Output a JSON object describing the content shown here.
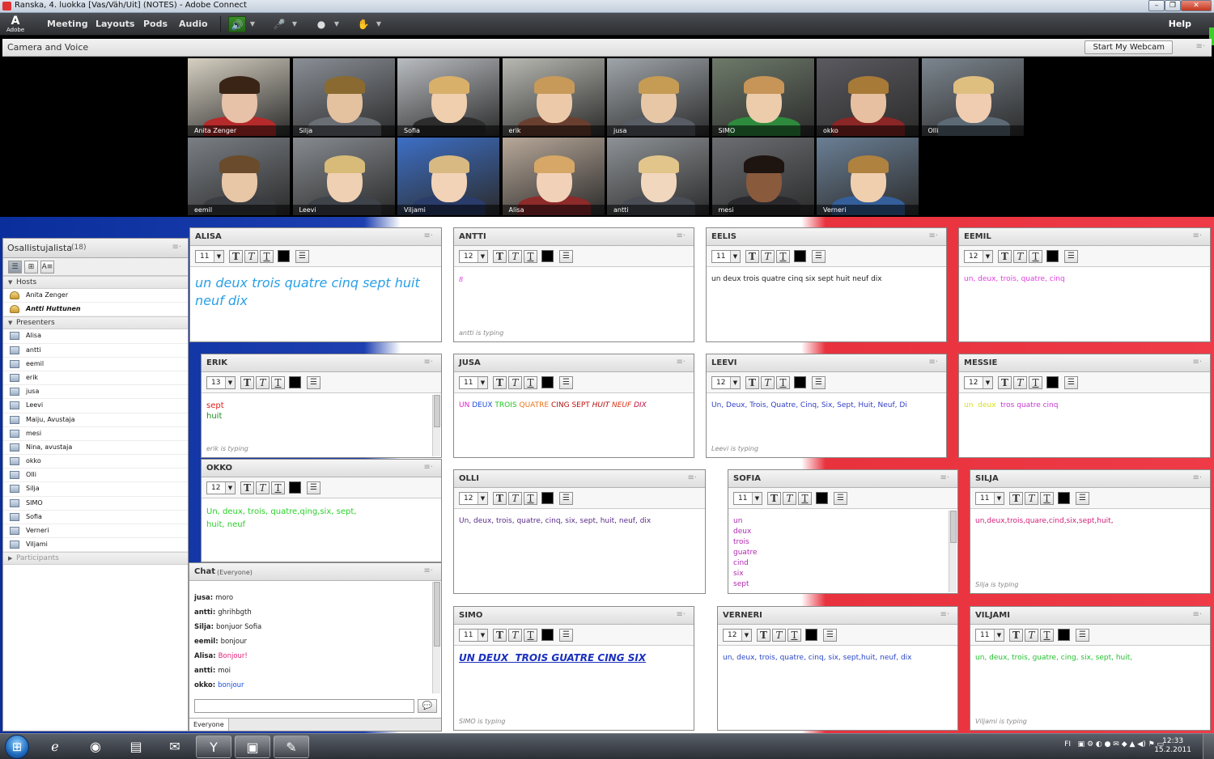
{
  "window": {
    "title": "Ranska, 4. luokka [Vas/Väh/Uit] (NOTES) - Adobe Connect"
  },
  "menubar": {
    "logo": "Adobe",
    "items": [
      "Meeting",
      "Layouts",
      "Pods",
      "Audio"
    ],
    "help": "Help"
  },
  "camera_pod": {
    "title": "Camera and Voice",
    "start_webcam": "Start My Webcam",
    "feeds": [
      {
        "name": "Anita Zenger"
      },
      {
        "name": "Silja"
      },
      {
        "name": "Sofia"
      },
      {
        "name": "erik"
      },
      {
        "name": "jusa"
      },
      {
        "name": "SIMO"
      },
      {
        "name": "okko"
      },
      {
        "name": "Olli"
      },
      {
        "name": "eemil"
      },
      {
        "name": "Leevi"
      },
      {
        "name": "Viljami"
      },
      {
        "name": "Alisa"
      },
      {
        "name": "antti"
      },
      {
        "name": "mesi"
      },
      {
        "name": "Verneri"
      }
    ]
  },
  "attendees": {
    "title": "Osallistujalista",
    "count": "(18)",
    "hosts_label": "Hosts",
    "hosts": [
      "Anita Zenger",
      "Antti Huttunen"
    ],
    "presenters_label": "Presenters",
    "presenters": [
      "Alisa",
      "antti",
      "eemil",
      "erik",
      "jusa",
      "Leevi",
      "Maiju, Avustaja",
      "mesi",
      "Nina, avustaja",
      "okko",
      "Olli",
      "Silja",
      "SIMO",
      "Sofia",
      "Verneri",
      "Viljami"
    ],
    "participants_label": "Participants"
  },
  "notes": {
    "alisa": {
      "title": "ALISA",
      "size": "11",
      "text": "un deux trois quatre cinq sept huit neuf dix",
      "typing": ""
    },
    "antti": {
      "title": "ANTTI",
      "size": "12",
      "text": "8",
      "typing": "antti is typing"
    },
    "eelis": {
      "title": "EELIS",
      "size": "11",
      "text": "un deux trois quatre cinq six sept huit neuf dix",
      "typing": ""
    },
    "eemil": {
      "title": "EEMIL",
      "size": "12",
      "text": "un, deux, trois, quatre, cinq",
      "typing": ""
    },
    "erik": {
      "title": "ERIK",
      "size": "13",
      "line1": "sept",
      "line2": "huit",
      "typing": "erik is typing"
    },
    "jusa": {
      "title": "JUSA",
      "size": "11",
      "words": [
        "UN",
        "DEUX",
        "TROIS",
        "QUATRE",
        "CING",
        "SEPT",
        "HUIT",
        "NEUF",
        "DIX"
      ],
      "typing": ""
    },
    "leevi": {
      "title": "LEEVI",
      "size": "12",
      "text": "Un, Deux, Trois, Quatre, Cinq, Six, Sept, Huit, Neuf, Di",
      "typing": "Leevi is typing"
    },
    "messie": {
      "title": "MESSIE",
      "size": "12",
      "text1": "un  deux",
      "text2": "tros quatre cinq",
      "typing": ""
    },
    "okko": {
      "title": "OKKO",
      "size": "12",
      "text": "Un, deux, trois, quatre,qing,six, sept,\nhuit, neuf",
      "typing": ""
    },
    "olli": {
      "title": "OLLI",
      "size": "12",
      "text": "Un, deux, trois, quatre, cinq, six, sept, huit, neuf, dix",
      "typing": ""
    },
    "sofia": {
      "title": "SOFIA",
      "size": "11",
      "lines": [
        "un",
        "deux",
        "trois",
        "guatre",
        "cind",
        "six",
        "sept"
      ],
      "typing": ""
    },
    "silja": {
      "title": "SILJA",
      "size": "11",
      "text": "un,deux,trois,quare,cind,six,sept,huit,",
      "typing": "Silja is typing"
    },
    "simo": {
      "title": "SIMO",
      "size": "11",
      "text": "UN DEUX  TROIS GUATRE CING SIX",
      "typing": "SIMO is typing"
    },
    "verneri": {
      "title": "VERNERI",
      "size": "12",
      "text": "un, deux, trois, quatre, cinq, six, sept,huit, neuf, dix",
      "typing": ""
    },
    "viljami": {
      "title": "VILJAMI",
      "size": "11",
      "text": "un, deux, trois, guatre, cing, six, sept, huit,",
      "typing": "Viljami is typing"
    }
  },
  "chat": {
    "title": "Chat",
    "scope": "(Everyone)",
    "messages": [
      {
        "who": "jusa:",
        "text": "moro"
      },
      {
        "who": "antti:",
        "text": "ghrihbgth"
      },
      {
        "who": "Silja:",
        "text": "bonjuor Sofia"
      },
      {
        "who": "eemil:",
        "text": "bonjour"
      },
      {
        "who": "Alisa:",
        "text": "Bonjour!"
      },
      {
        "who": "antti:",
        "text": "moi"
      },
      {
        "who": "okko:",
        "text": "bonjour"
      }
    ],
    "tab": "Everyone"
  },
  "taskbar": {
    "lang": "FI",
    "time": "12:33",
    "date": "15.2.2011"
  },
  "colors": {
    "blue": "#1d3fb0",
    "red": "#ee3b47",
    "mic_green": "#3b8d29"
  }
}
